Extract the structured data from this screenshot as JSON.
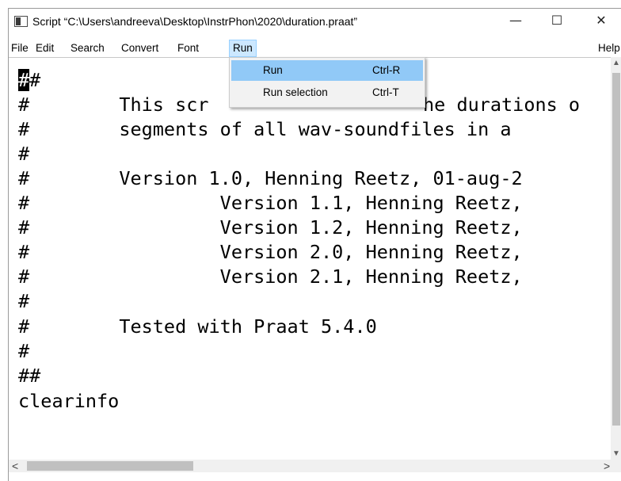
{
  "window": {
    "title": "Script “C:\\Users\\andreeva\\Desktop\\InstrPhon\\2020\\duration.praat”",
    "controls": {
      "minimize": "—",
      "maximize": "☐",
      "close": "✕"
    }
  },
  "menubar": {
    "file": "File",
    "edit": "Edit",
    "search": "Search",
    "convert": "Convert",
    "font": "Font",
    "run": "Run",
    "help": "Help"
  },
  "run_menu": {
    "items": [
      {
        "label": "Run",
        "shortcut": "Ctrl-R"
      },
      {
        "label": "Run selection",
        "shortcut": "Ctrl-T"
      }
    ]
  },
  "editor": {
    "lines": [
      {
        "cursor": "#",
        "text": "#"
      },
      {
        "text": "#        This scr"
      },
      {
        "text": "#        segments of all wav-soundfiles in a"
      },
      {
        "text": "#"
      },
      {
        "text": "#        Version 1.0, Henning Reetz, 01-aug-2"
      },
      {
        "text": "#                 Version 1.1, Henning Reetz,"
      },
      {
        "text": "#                 Version 1.2, Henning Reetz,"
      },
      {
        "text": "#                 Version 2.0, Henning Reetz,"
      },
      {
        "text": "#                 Version 2.1, Henning Reetz,"
      },
      {
        "text": "#"
      },
      {
        "text": "#        Tested with Praat 5.4.0"
      },
      {
        "text": "#"
      },
      {
        "text": "##"
      },
      {
        "text": "clearinfo"
      }
    ],
    "line1_tail": "he durations o"
  },
  "icons": {
    "scroll_up": "▲",
    "scroll_down": "▼",
    "scroll_left": "<",
    "scroll_right": ">"
  }
}
